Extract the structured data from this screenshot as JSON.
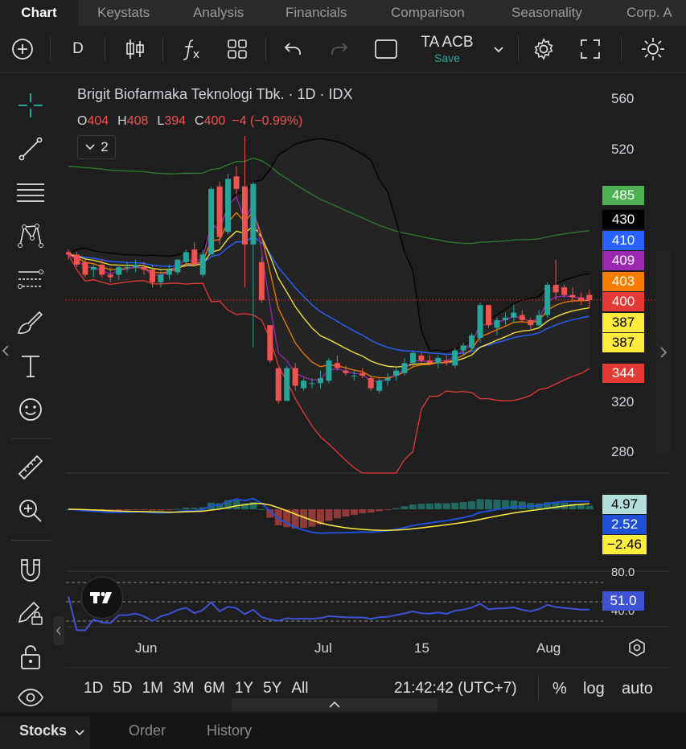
{
  "tabs": [
    "Chart",
    "Keystats",
    "Analysis",
    "Financials",
    "Comparison",
    "Seasonality",
    "Corp. A"
  ],
  "toolbar": {
    "interval": "D",
    "template_name": "TA ACB",
    "template_status": "Save"
  },
  "legend": {
    "title": "Brigit Biofarmaka Teknologi Tbk. · 1D · IDX",
    "o_label": "O",
    "o_value": "404",
    "h_label": "H",
    "h_value": "408",
    "l_label": "L",
    "l_value": "394",
    "c_label": "C",
    "c_value": "400",
    "change": "−4 (−0.99%)",
    "collapse_count": "2"
  },
  "price_axis": [
    "560",
    "520",
    "320",
    "280"
  ],
  "price_badges": [
    {
      "value": "485",
      "color": "#4caf50",
      "text_color": "#ffffff"
    },
    {
      "value": "430",
      "color": "#000000",
      "text_color": "#ffffff"
    },
    {
      "value": "410",
      "color": "#2962ff",
      "text_color": "#ffffff"
    },
    {
      "value": "409",
      "color": "#9c27b0",
      "text_color": "#ffffff"
    },
    {
      "value": "403",
      "color": "#f57c00",
      "text_color": "#ffffff"
    },
    {
      "value": "400",
      "color": "#e53935",
      "text_color": "#ffffff"
    },
    {
      "value": "387",
      "color": "#ffeb3b",
      "text_color": "#000000"
    },
    {
      "value": "387",
      "color": "#ffeb3b",
      "text_color": "#000000"
    },
    {
      "value": "344",
      "color": "#e53935",
      "text_color": "#ffffff"
    }
  ],
  "macd_badges": [
    {
      "value": "4.97",
      "color": "#b2dfdb",
      "text_color": "#000000"
    },
    {
      "value": "2.52",
      "color": "#1e4fd6",
      "text_color": "#ffffff"
    },
    {
      "value": "−2.46",
      "color": "#ffeb3b",
      "text_color": "#000000"
    }
  ],
  "rsi_axis": [
    "80.0",
    "40.0"
  ],
  "rsi_badge": {
    "value": "51.0",
    "color": "#3d52d5",
    "text_color": "#ffffff"
  },
  "time_axis": [
    "Jun",
    "Jul",
    "15",
    "Aug"
  ],
  "ranges": [
    "1D",
    "5D",
    "1M",
    "3M",
    "6M",
    "1Y",
    "5Y",
    "All"
  ],
  "clock": "21:42:42 (UTC+7)",
  "scale_opts": [
    "%",
    "log",
    "auto"
  ],
  "bottom_tabs": [
    "Stocks",
    "Order",
    "History"
  ],
  "chart_data": {
    "type": "candlestick",
    "y_range": [
      280,
      560
    ],
    "candles": [
      {
        "o": 438,
        "h": 440,
        "l": 432,
        "c": 436
      },
      {
        "o": 436,
        "h": 438,
        "l": 426,
        "c": 428
      },
      {
        "o": 430,
        "h": 432,
        "l": 418,
        "c": 420
      },
      {
        "o": 424,
        "h": 428,
        "l": 418,
        "c": 426
      },
      {
        "o": 428,
        "h": 432,
        "l": 418,
        "c": 420
      },
      {
        "o": 420,
        "h": 426,
        "l": 414,
        "c": 418
      },
      {
        "o": 420,
        "h": 428,
        "l": 416,
        "c": 426
      },
      {
        "o": 426,
        "h": 430,
        "l": 422,
        "c": 426
      },
      {
        "o": 426,
        "h": 432,
        "l": 422,
        "c": 428
      },
      {
        "o": 426,
        "h": 430,
        "l": 420,
        "c": 424
      },
      {
        "o": 424,
        "h": 428,
        "l": 410,
        "c": 414
      },
      {
        "o": 414,
        "h": 424,
        "l": 410,
        "c": 420
      },
      {
        "o": 420,
        "h": 428,
        "l": 416,
        "c": 424
      },
      {
        "o": 422,
        "h": 432,
        "l": 420,
        "c": 432
      },
      {
        "o": 430,
        "h": 440,
        "l": 426,
        "c": 438
      },
      {
        "o": 440,
        "h": 446,
        "l": 426,
        "c": 428
      },
      {
        "o": 420,
        "h": 440,
        "l": 418,
        "c": 436
      },
      {
        "o": 436,
        "h": 490,
        "l": 436,
        "c": 488
      },
      {
        "o": 490,
        "h": 494,
        "l": 444,
        "c": 450
      },
      {
        "o": 454,
        "h": 500,
        "l": 452,
        "c": 496
      },
      {
        "o": 498,
        "h": 506,
        "l": 484,
        "c": 488
      },
      {
        "o": 490,
        "h": 530,
        "l": 410,
        "c": 444
      },
      {
        "o": 444,
        "h": 494,
        "l": 362,
        "c": 492
      },
      {
        "o": 430,
        "h": 434,
        "l": 398,
        "c": 400
      },
      {
        "o": 380,
        "h": 380,
        "l": 350,
        "c": 352
      },
      {
        "o": 346,
        "h": 346,
        "l": 318,
        "c": 320
      },
      {
        "o": 320,
        "h": 348,
        "l": 320,
        "c": 346
      },
      {
        "o": 346,
        "h": 350,
        "l": 328,
        "c": 332
      },
      {
        "o": 330,
        "h": 338,
        "l": 328,
        "c": 336
      },
      {
        "o": 334,
        "h": 338,
        "l": 330,
        "c": 334
      },
      {
        "o": 334,
        "h": 344,
        "l": 330,
        "c": 338
      },
      {
        "o": 336,
        "h": 354,
        "l": 334,
        "c": 352
      },
      {
        "o": 350,
        "h": 356,
        "l": 344,
        "c": 346
      },
      {
        "o": 344,
        "h": 348,
        "l": 340,
        "c": 342
      },
      {
        "o": 340,
        "h": 344,
        "l": 336,
        "c": 340
      },
      {
        "o": 342,
        "h": 346,
        "l": 338,
        "c": 340
      },
      {
        "o": 338,
        "h": 340,
        "l": 328,
        "c": 330
      },
      {
        "o": 328,
        "h": 338,
        "l": 326,
        "c": 336
      },
      {
        "o": 336,
        "h": 342,
        "l": 332,
        "c": 338
      },
      {
        "o": 340,
        "h": 346,
        "l": 336,
        "c": 344
      },
      {
        "o": 342,
        "h": 354,
        "l": 340,
        "c": 350
      },
      {
        "o": 350,
        "h": 360,
        "l": 346,
        "c": 358
      },
      {
        "o": 356,
        "h": 358,
        "l": 350,
        "c": 352
      },
      {
        "o": 352,
        "h": 356,
        "l": 348,
        "c": 350
      },
      {
        "o": 350,
        "h": 356,
        "l": 346,
        "c": 354
      },
      {
        "o": 352,
        "h": 356,
        "l": 348,
        "c": 350
      },
      {
        "o": 348,
        "h": 362,
        "l": 346,
        "c": 360
      },
      {
        "o": 360,
        "h": 366,
        "l": 356,
        "c": 364
      },
      {
        "o": 362,
        "h": 374,
        "l": 360,
        "c": 372
      },
      {
        "o": 370,
        "h": 398,
        "l": 366,
        "c": 396
      },
      {
        "o": 396,
        "h": 396,
        "l": 378,
        "c": 380
      },
      {
        "o": 378,
        "h": 386,
        "l": 372,
        "c": 384
      },
      {
        "o": 384,
        "h": 390,
        "l": 380,
        "c": 386
      },
      {
        "o": 386,
        "h": 396,
        "l": 382,
        "c": 390
      },
      {
        "o": 388,
        "h": 392,
        "l": 382,
        "c": 384
      },
      {
        "o": 384,
        "h": 386,
        "l": 376,
        "c": 380
      },
      {
        "o": 380,
        "h": 392,
        "l": 378,
        "c": 388
      },
      {
        "o": 388,
        "h": 414,
        "l": 386,
        "c": 412
      },
      {
        "o": 412,
        "h": 432,
        "l": 400,
        "c": 406
      },
      {
        "o": 410,
        "h": 412,
        "l": 402,
        "c": 404
      },
      {
        "o": 404,
        "h": 410,
        "l": 398,
        "c": 402
      },
      {
        "o": 402,
        "h": 406,
        "l": 396,
        "c": 400
      },
      {
        "o": 404,
        "h": 408,
        "l": 394,
        "c": 400
      }
    ],
    "rsi_scale": [
      40,
      80
    ],
    "rsi_latest": 51.0,
    "macd": {
      "histogram": 4.97,
      "macd": 2.52,
      "signal": -2.46
    }
  }
}
